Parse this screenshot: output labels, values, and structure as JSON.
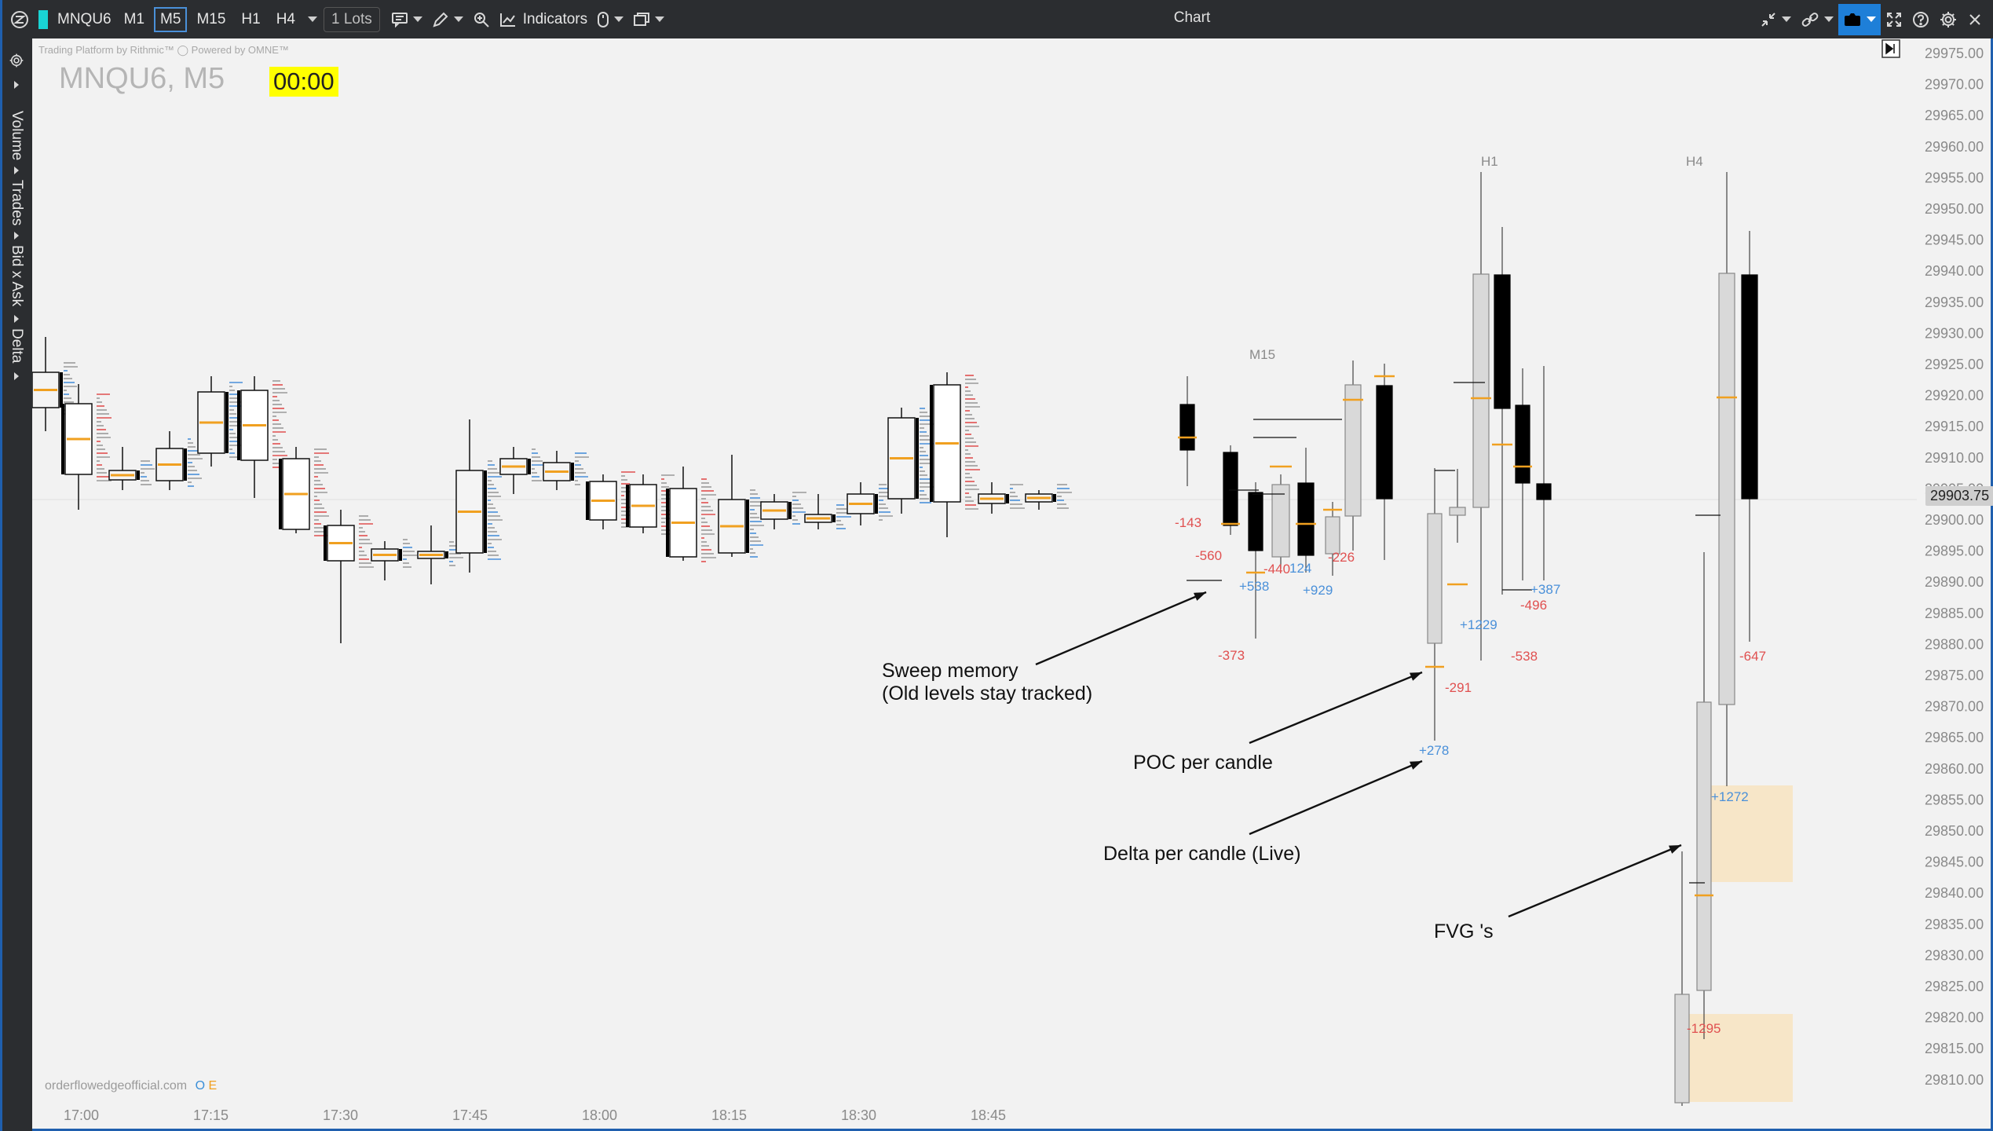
{
  "toolbar": {
    "symbol": "MNQU6",
    "symbol_color": "#19d4d4",
    "timeframes": [
      {
        "label": "M1",
        "selected": false
      },
      {
        "label": "M5",
        "selected": true
      },
      {
        "label": "M15",
        "selected": false
      },
      {
        "label": "H1",
        "selected": false
      },
      {
        "label": "H4",
        "selected": false
      }
    ],
    "lots": "1 Lots",
    "indicators_label": "Indicators",
    "window_title": "Chart",
    "icons": [
      "logo-icon",
      "timeframe-dropdown-icon",
      "chat-icon",
      "pencil-icon",
      "zoom-icon",
      "indicators-icon",
      "mouse-icon",
      "layout-icon",
      "minimize-arrows-icon",
      "link-icon",
      "camera-icon",
      "fullscreen-icon",
      "help-icon",
      "settings-icon",
      "close-icon"
    ]
  },
  "sidebar": {
    "labels": [
      "Volume",
      "Trades",
      "Bid x Ask",
      "Delta"
    ],
    "icons": [
      "gear-icon",
      "expand-icon"
    ]
  },
  "chart": {
    "platform_text": "Trading Platform by Rithmic™  ◯ Powered by OMNE™",
    "title": "MNQU6, M5",
    "timer": "00:00",
    "brand": "orderflowedgeofficial.com",
    "brand_mark_o": "O",
    "brand_mark_e": "E",
    "last_price": "29903.75",
    "y_labels": [
      "29975.00",
      "29970.00",
      "29965.00",
      "29960.00",
      "29955.00",
      "29950.00",
      "29945.00",
      "29940.00",
      "29935.00",
      "29930.00",
      "29925.00",
      "29920.00",
      "29915.00",
      "29910.00",
      "29905.00",
      "29900.00",
      "29895.00",
      "29890.00",
      "29885.00",
      "29880.00",
      "29875.00",
      "29870.00",
      "29865.00",
      "29860.00",
      "29855.00",
      "29850.00",
      "29845.00",
      "29840.00",
      "29835.00",
      "29830.00",
      "29825.00",
      "29820.00",
      "29815.00",
      "29810.00"
    ],
    "x_labels": [
      "17:00",
      "17:15",
      "17:30",
      "17:45",
      "18:00",
      "18:15",
      "18:30",
      "18:45"
    ],
    "htf_labels": [
      "M15",
      "H1",
      "H4"
    ],
    "deltas": [
      {
        "t": "-143",
        "c": "neg"
      },
      {
        "t": "-560",
        "c": "neg"
      },
      {
        "t": "+538",
        "c": "pos"
      },
      {
        "t": "-373",
        "c": "neg"
      },
      {
        "t": "-440",
        "c": "neg"
      },
      {
        "t": "124",
        "c": "pos"
      },
      {
        "t": "+929",
        "c": "pos"
      },
      {
        "t": "-226",
        "c": "neg"
      },
      {
        "t": "-291",
        "c": "neg"
      },
      {
        "t": "+278",
        "c": "pos"
      },
      {
        "t": "+1229",
        "c": "pos"
      },
      {
        "t": "-496",
        "c": "neg"
      },
      {
        "t": "-538",
        "c": "neg"
      },
      {
        "t": "+387",
        "c": "pos"
      },
      {
        "t": "+1272",
        "c": "pos"
      },
      {
        "t": "-1295",
        "c": "neg"
      },
      {
        "t": "-647",
        "c": "neg"
      }
    ],
    "annotations": [
      {
        "line1": "Sweep memory",
        "line2": "(Old levels stay tracked)"
      },
      {
        "line1": "POC per candle",
        "line2": ""
      },
      {
        "line1": "Delta per candle (Live)",
        "line2": ""
      },
      {
        "line1": "FVG 's",
        "line2": ""
      }
    ],
    "colors": {
      "neg": "#e05050",
      "pos": "#4a90d9",
      "poc": "#f0a020",
      "fvg": "#f7e6c8"
    }
  }
}
